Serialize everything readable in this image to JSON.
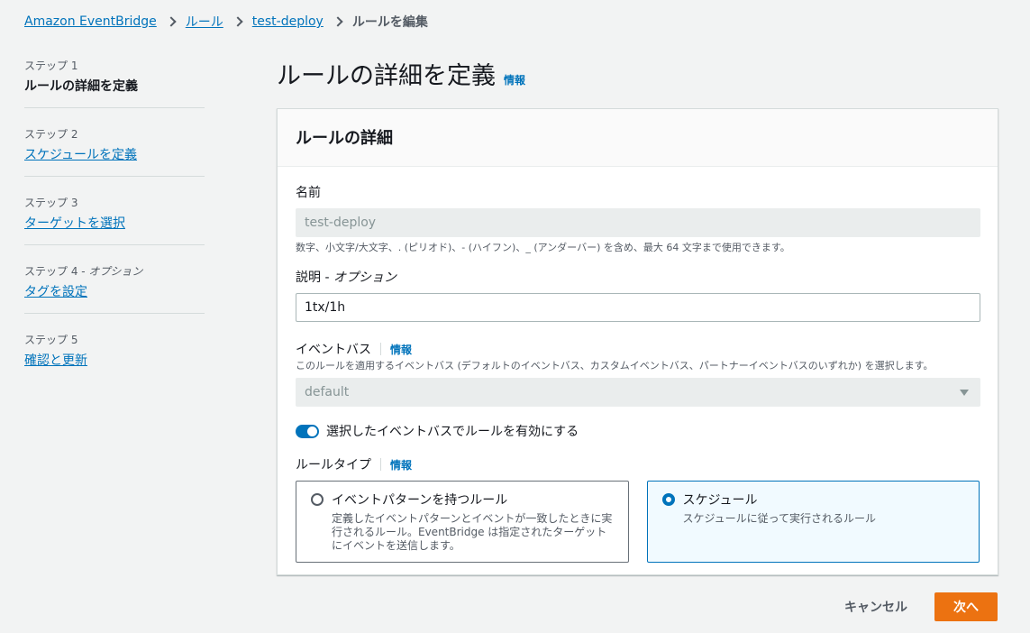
{
  "breadcrumb": {
    "items": [
      "Amazon EventBridge",
      "ルール",
      "test-deploy"
    ],
    "current": "ルールを編集"
  },
  "steps": [
    {
      "num": "ステップ 1",
      "label": "ルールの詳細を定義"
    },
    {
      "num": "ステップ 2",
      "label": "スケジュールを定義"
    },
    {
      "num": "ステップ 3",
      "label": "ターゲットを選択"
    },
    {
      "num": "ステップ 4 - ",
      "num_optional": "オプション",
      "label": "タグを設定"
    },
    {
      "num": "ステップ 5",
      "label": "確認と更新"
    }
  ],
  "page": {
    "title": "ルールの詳細を定義",
    "info": "情報"
  },
  "panel": {
    "title": "ルールの詳細",
    "name": {
      "label": "名前",
      "value": "test-deploy",
      "hint": "数字、小文字/大文字、. (ピリオド)、- (ハイフン)、_ (アンダーバー) を含め、最大 64 文字まで使用できます。"
    },
    "description": {
      "label": "説明 - ",
      "label_optional": "オプション",
      "value": "1tx/1h"
    },
    "event_bus": {
      "label": "イベントバス",
      "info": "情報",
      "hint": "このルールを適用するイベントバス (デフォルトのイベントバス、カスタムイベントバス、パートナーイベントバスのいずれか) を選択します。",
      "value": "default"
    },
    "toggle": {
      "label": "選択したイベントバスでルールを有効にする",
      "enabled": true
    },
    "rule_type": {
      "label": "ルールタイプ",
      "info": "情報",
      "options": [
        {
          "title": "イベントパターンを持つルール",
          "desc": "定義したイベントパターンとイベントが一致したときに実行されるルール。EventBridge は指定されたターゲットにイベントを送信します。",
          "selected": false
        },
        {
          "title": "スケジュール",
          "desc": "スケジュールに従って実行されるルール",
          "selected": true
        }
      ]
    }
  },
  "footer": {
    "cancel": "キャンセル",
    "next": "次へ"
  },
  "colors": {
    "link": "#0073bb",
    "primary": "#ec7211",
    "background": "#f2f3f3"
  }
}
